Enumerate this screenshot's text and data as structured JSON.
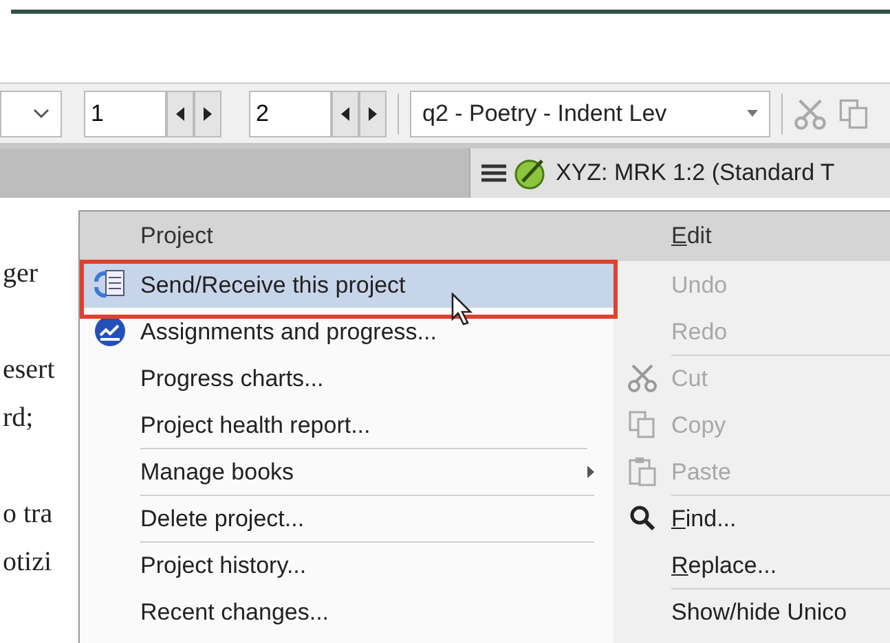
{
  "toolbar": {
    "chapter": "1",
    "verse": "2",
    "style": "q2 - Poetry - Indent Lev"
  },
  "reference_bar": {
    "text": "XYZ: MRK 1:2 (Standard T"
  },
  "document_lines": [
    {
      "kind": "blank"
    },
    {
      "kind": "text",
      "text": "ger"
    },
    {
      "kind": "blank"
    },
    {
      "kind": "text",
      "text": "esert"
    },
    {
      "kind": "text",
      "text": "rd;"
    },
    {
      "kind": "blank"
    },
    {
      "kind": "text",
      "text": "o tra"
    },
    {
      "kind": "text",
      "text": "otizi"
    }
  ],
  "menu": {
    "project": {
      "title": "Project",
      "items": [
        {
          "label": "Send/Receive this project",
          "kind": "sync",
          "selected": true,
          "submenu": false,
          "separator_before": false
        },
        {
          "label": "Assignments and progress...",
          "kind": "chart",
          "selected": false,
          "submenu": false,
          "separator_before": false
        },
        {
          "label": "Progress charts...",
          "kind": "plain",
          "selected": false,
          "submenu": false,
          "separator_before": false
        },
        {
          "label": "Project health report...",
          "kind": "plain",
          "selected": false,
          "submenu": false,
          "separator_before": false
        },
        {
          "label": "Manage books",
          "kind": "plain",
          "selected": false,
          "submenu": true,
          "separator_before": true
        },
        {
          "label": "Delete project...",
          "kind": "plain",
          "selected": false,
          "submenu": false,
          "separator_before": true
        },
        {
          "label": "Project history...",
          "kind": "plain",
          "selected": false,
          "submenu": false,
          "separator_before": true
        },
        {
          "label": "Recent changes...",
          "kind": "plain",
          "selected": false,
          "submenu": false,
          "separator_before": false
        }
      ]
    },
    "edit": {
      "title": {
        "accel": "E",
        "rest": "dit"
      },
      "items": [
        {
          "rest": "Undo",
          "kind": "plain",
          "disabled": true,
          "separator_before": false
        },
        {
          "rest": "Redo",
          "kind": "plain",
          "disabled": true,
          "separator_before": false
        },
        {
          "rest": "Cut",
          "kind": "cut",
          "disabled": true,
          "separator_before": true
        },
        {
          "rest": "Copy",
          "kind": "copy",
          "disabled": true,
          "separator_before": false
        },
        {
          "rest": "Paste",
          "kind": "paste",
          "disabled": true,
          "separator_before": false
        },
        {
          "accel": "F",
          "rest": "ind...",
          "kind": "find",
          "disabled": false,
          "separator_before": true
        },
        {
          "accel": "R",
          "rest": "eplace...",
          "kind": "plain",
          "disabled": false,
          "separator_before": false
        },
        {
          "rest": "Show/hide Unico",
          "kind": "plain",
          "disabled": false,
          "separator_before": true
        }
      ]
    }
  }
}
